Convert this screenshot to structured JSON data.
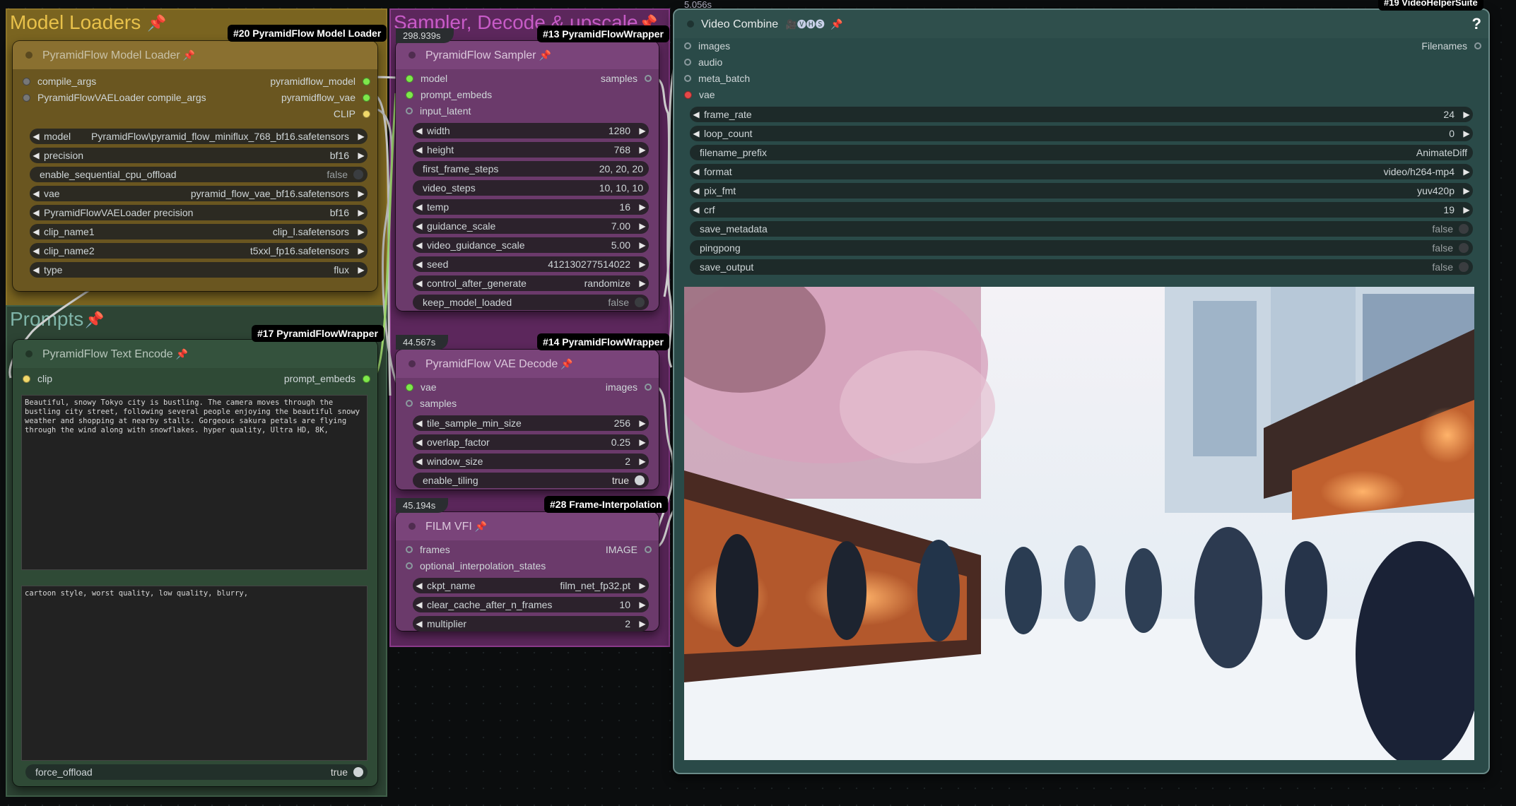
{
  "groups": {
    "model_loaders": "Model Loaders",
    "prompts": "Prompts",
    "sampler": "Sampler, Decode & upscale"
  },
  "top_right_timer": "5.056s",
  "top_right_badge": "#19 VideoHelperSuite",
  "node_model_loader": {
    "badge": "#20 PyramidFlow Model Loader",
    "title": "PyramidFlow Model Loader",
    "inputs": [
      "compile_args",
      "PyramidFlowVAELoader compile_args"
    ],
    "outputs": [
      "pyramidflow_model",
      "pyramidflow_vae",
      "CLIP"
    ],
    "widgets": [
      {
        "name": "model",
        "value": "PyramidFlow\\pyramid_flow_miniflux_768_bf16.safetensors"
      },
      {
        "name": "precision",
        "value": "bf16"
      },
      {
        "name": "enable_sequential_cpu_offload",
        "value": "false"
      },
      {
        "name": "vae",
        "value": "pyramid_flow_vae_bf16.safetensors"
      },
      {
        "name": "PyramidFlowVAELoader precision",
        "value": "bf16"
      },
      {
        "name": "clip_name1",
        "value": "clip_l.safetensors"
      },
      {
        "name": "clip_name2",
        "value": "t5xxl_fp16.safetensors"
      },
      {
        "name": "type",
        "value": "flux"
      }
    ]
  },
  "node_text_encode": {
    "badge": "#17 PyramidFlowWrapper",
    "title": "PyramidFlow Text Encode",
    "input": "clip",
    "output": "prompt_embeds",
    "positive_prompt": "Beautiful, snowy Tokyo city is bustling. The camera moves through the bustling city street, following several people enjoying the beautiful snowy weather and shopping at nearby stalls. Gorgeous sakura petals are flying through the wind along with snowflakes. hyper quality, Ultra HD, 8K,",
    "negative_prompt": "cartoon style, worst quality, low quality, blurry,",
    "force_offload_name": "force_offload",
    "force_offload_value": "true"
  },
  "node_sampler": {
    "timer": "298.939s",
    "badge": "#13 PyramidFlowWrapper",
    "title": "PyramidFlow Sampler",
    "inputs": [
      "model",
      "prompt_embeds",
      "input_latent"
    ],
    "output": "samples",
    "widgets": [
      {
        "name": "width",
        "value": "1280"
      },
      {
        "name": "height",
        "value": "768"
      },
      {
        "name": "first_frame_steps",
        "value": "20, 20, 20"
      },
      {
        "name": "video_steps",
        "value": "10, 10, 10"
      },
      {
        "name": "temp",
        "value": "16"
      },
      {
        "name": "guidance_scale",
        "value": "7.00"
      },
      {
        "name": "video_guidance_scale",
        "value": "5.00"
      },
      {
        "name": "seed",
        "value": "412130277514022"
      },
      {
        "name": "control_after_generate",
        "value": "randomize"
      },
      {
        "name": "keep_model_loaded",
        "value": "false"
      }
    ]
  },
  "node_vae_decode": {
    "timer": "44.567s",
    "badge": "#14 PyramidFlowWrapper",
    "title": "PyramidFlow VAE Decode",
    "inputs": [
      "vae",
      "samples"
    ],
    "output": "images",
    "widgets": [
      {
        "name": "tile_sample_min_size",
        "value": "256"
      },
      {
        "name": "overlap_factor",
        "value": "0.25"
      },
      {
        "name": "window_size",
        "value": "2"
      },
      {
        "name": "enable_tiling",
        "value": "true"
      }
    ]
  },
  "node_film_vfi": {
    "timer": "45.194s",
    "badge": "#28 Frame-Interpolation",
    "title": "FILM VFI",
    "inputs": [
      "frames",
      "optional_interpolation_states"
    ],
    "output": "IMAGE",
    "widgets": [
      {
        "name": "ckpt_name",
        "value": "film_net_fp32.pt"
      },
      {
        "name": "clear_cache_after_n_frames",
        "value": "10"
      },
      {
        "name": "multiplier",
        "value": "2"
      }
    ]
  },
  "node_video_combine": {
    "title": "Video Combine",
    "title_icons": "🎥🅥🅗🅢",
    "help": "?",
    "inputs": [
      "images",
      "audio",
      "meta_batch",
      "vae"
    ],
    "output": "Filenames",
    "widgets": [
      {
        "name": "frame_rate",
        "value": "24"
      },
      {
        "name": "loop_count",
        "value": "0"
      },
      {
        "name": "filename_prefix",
        "value": "AnimateDiff"
      },
      {
        "name": "format",
        "value": "video/h264-mp4"
      },
      {
        "name": "pix_fmt",
        "value": "yuv420p"
      },
      {
        "name": "crf",
        "value": "19"
      },
      {
        "name": "save_metadata",
        "value": "false"
      },
      {
        "name": "pingpong",
        "value": "false"
      },
      {
        "name": "save_output",
        "value": "false"
      }
    ]
  },
  "colors": {
    "model_group": "#7a6420",
    "prompt_group": "#3f5a47",
    "sampler_group": "#6b2f6b",
    "node_body": "#2f3436",
    "video_node": "#2a4a48",
    "link_white": "#d8d8d8",
    "pin": "#e0385b"
  }
}
